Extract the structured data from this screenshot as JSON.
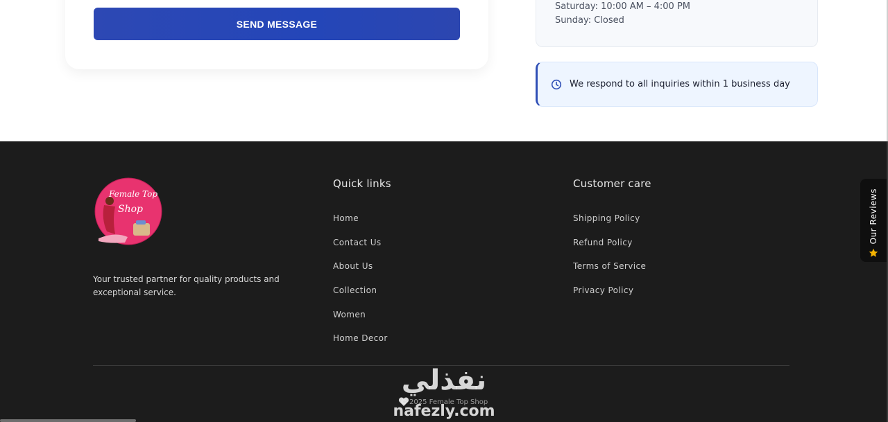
{
  "form": {
    "send_label": "SEND MESSAGE"
  },
  "hours": {
    "saturday": "Saturday: 10:00 AM – 4:00 PM",
    "sunday": "Sunday: Closed"
  },
  "notice": {
    "icon": "clock-icon",
    "text": "We respond to all inquiries within 1 business day"
  },
  "footer": {
    "logo_text": [
      "Female Top",
      "Shop"
    ],
    "tagline": "Your trusted partner for quality products and exceptional service.",
    "quick_links": {
      "title": "Quick links",
      "items": [
        "Home",
        "Contact Us",
        "About Us",
        "Collection",
        "Women",
        "Home Decor"
      ]
    },
    "customer_care": {
      "title": "Customer care",
      "items": [
        "Shipping Policy",
        "Refund Policy",
        "Terms of Service",
        "Privacy Policy"
      ]
    },
    "copyright": "© 2025 Female Top Shop"
  },
  "reviews_tab": {
    "label": "Our Reviews",
    "icon": "star-icon"
  },
  "watermark": {
    "arabic": "نفذلي",
    "latin": "nafezly.com"
  },
  "colors": {
    "accent_blue": "#2446b8",
    "footer_bg": "#1c1c1c",
    "notice_bg": "#eef5ff",
    "star": "#f5b301",
    "logo_pink": "#e8336f"
  }
}
